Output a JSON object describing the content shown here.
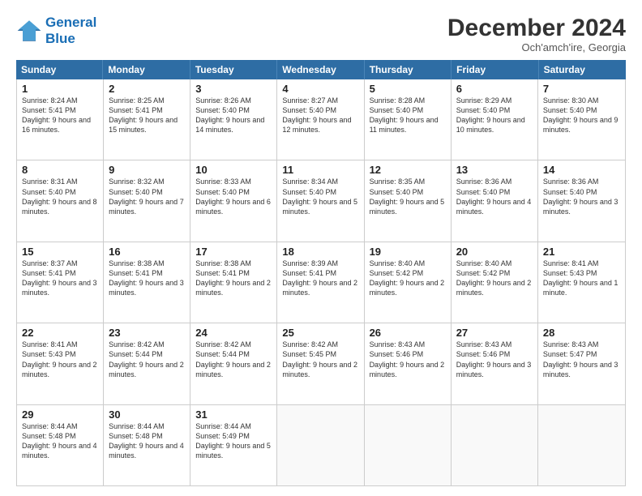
{
  "header": {
    "logo_line1": "General",
    "logo_line2": "Blue",
    "month_title": "December 2024",
    "subtitle": "Och'amch'ire, Georgia"
  },
  "days_of_week": [
    "Sunday",
    "Monday",
    "Tuesday",
    "Wednesday",
    "Thursday",
    "Friday",
    "Saturday"
  ],
  "weeks": [
    [
      {
        "day": "1",
        "info": "Sunrise: 8:24 AM\nSunset: 5:41 PM\nDaylight: 9 hours and 16 minutes."
      },
      {
        "day": "2",
        "info": "Sunrise: 8:25 AM\nSunset: 5:41 PM\nDaylight: 9 hours and 15 minutes."
      },
      {
        "day": "3",
        "info": "Sunrise: 8:26 AM\nSunset: 5:40 PM\nDaylight: 9 hours and 14 minutes."
      },
      {
        "day": "4",
        "info": "Sunrise: 8:27 AM\nSunset: 5:40 PM\nDaylight: 9 hours and 12 minutes."
      },
      {
        "day": "5",
        "info": "Sunrise: 8:28 AM\nSunset: 5:40 PM\nDaylight: 9 hours and 11 minutes."
      },
      {
        "day": "6",
        "info": "Sunrise: 8:29 AM\nSunset: 5:40 PM\nDaylight: 9 hours and 10 minutes."
      },
      {
        "day": "7",
        "info": "Sunrise: 8:30 AM\nSunset: 5:40 PM\nDaylight: 9 hours and 9 minutes."
      }
    ],
    [
      {
        "day": "8",
        "info": "Sunrise: 8:31 AM\nSunset: 5:40 PM\nDaylight: 9 hours and 8 minutes."
      },
      {
        "day": "9",
        "info": "Sunrise: 8:32 AM\nSunset: 5:40 PM\nDaylight: 9 hours and 7 minutes."
      },
      {
        "day": "10",
        "info": "Sunrise: 8:33 AM\nSunset: 5:40 PM\nDaylight: 9 hours and 6 minutes."
      },
      {
        "day": "11",
        "info": "Sunrise: 8:34 AM\nSunset: 5:40 PM\nDaylight: 9 hours and 5 minutes."
      },
      {
        "day": "12",
        "info": "Sunrise: 8:35 AM\nSunset: 5:40 PM\nDaylight: 9 hours and 5 minutes."
      },
      {
        "day": "13",
        "info": "Sunrise: 8:36 AM\nSunset: 5:40 PM\nDaylight: 9 hours and 4 minutes."
      },
      {
        "day": "14",
        "info": "Sunrise: 8:36 AM\nSunset: 5:40 PM\nDaylight: 9 hours and 3 minutes."
      }
    ],
    [
      {
        "day": "15",
        "info": "Sunrise: 8:37 AM\nSunset: 5:41 PM\nDaylight: 9 hours and 3 minutes."
      },
      {
        "day": "16",
        "info": "Sunrise: 8:38 AM\nSunset: 5:41 PM\nDaylight: 9 hours and 3 minutes."
      },
      {
        "day": "17",
        "info": "Sunrise: 8:38 AM\nSunset: 5:41 PM\nDaylight: 9 hours and 2 minutes."
      },
      {
        "day": "18",
        "info": "Sunrise: 8:39 AM\nSunset: 5:41 PM\nDaylight: 9 hours and 2 minutes."
      },
      {
        "day": "19",
        "info": "Sunrise: 8:40 AM\nSunset: 5:42 PM\nDaylight: 9 hours and 2 minutes."
      },
      {
        "day": "20",
        "info": "Sunrise: 8:40 AM\nSunset: 5:42 PM\nDaylight: 9 hours and 2 minutes."
      },
      {
        "day": "21",
        "info": "Sunrise: 8:41 AM\nSunset: 5:43 PM\nDaylight: 9 hours and 1 minute."
      }
    ],
    [
      {
        "day": "22",
        "info": "Sunrise: 8:41 AM\nSunset: 5:43 PM\nDaylight: 9 hours and 2 minutes."
      },
      {
        "day": "23",
        "info": "Sunrise: 8:42 AM\nSunset: 5:44 PM\nDaylight: 9 hours and 2 minutes."
      },
      {
        "day": "24",
        "info": "Sunrise: 8:42 AM\nSunset: 5:44 PM\nDaylight: 9 hours and 2 minutes."
      },
      {
        "day": "25",
        "info": "Sunrise: 8:42 AM\nSunset: 5:45 PM\nDaylight: 9 hours and 2 minutes."
      },
      {
        "day": "26",
        "info": "Sunrise: 8:43 AM\nSunset: 5:46 PM\nDaylight: 9 hours and 2 minutes."
      },
      {
        "day": "27",
        "info": "Sunrise: 8:43 AM\nSunset: 5:46 PM\nDaylight: 9 hours and 3 minutes."
      },
      {
        "day": "28",
        "info": "Sunrise: 8:43 AM\nSunset: 5:47 PM\nDaylight: 9 hours and 3 minutes."
      }
    ],
    [
      {
        "day": "29",
        "info": "Sunrise: 8:44 AM\nSunset: 5:48 PM\nDaylight: 9 hours and 4 minutes."
      },
      {
        "day": "30",
        "info": "Sunrise: 8:44 AM\nSunset: 5:48 PM\nDaylight: 9 hours and 4 minutes."
      },
      {
        "day": "31",
        "info": "Sunrise: 8:44 AM\nSunset: 5:49 PM\nDaylight: 9 hours and 5 minutes."
      },
      {
        "day": "",
        "info": ""
      },
      {
        "day": "",
        "info": ""
      },
      {
        "day": "",
        "info": ""
      },
      {
        "day": "",
        "info": ""
      }
    ]
  ]
}
